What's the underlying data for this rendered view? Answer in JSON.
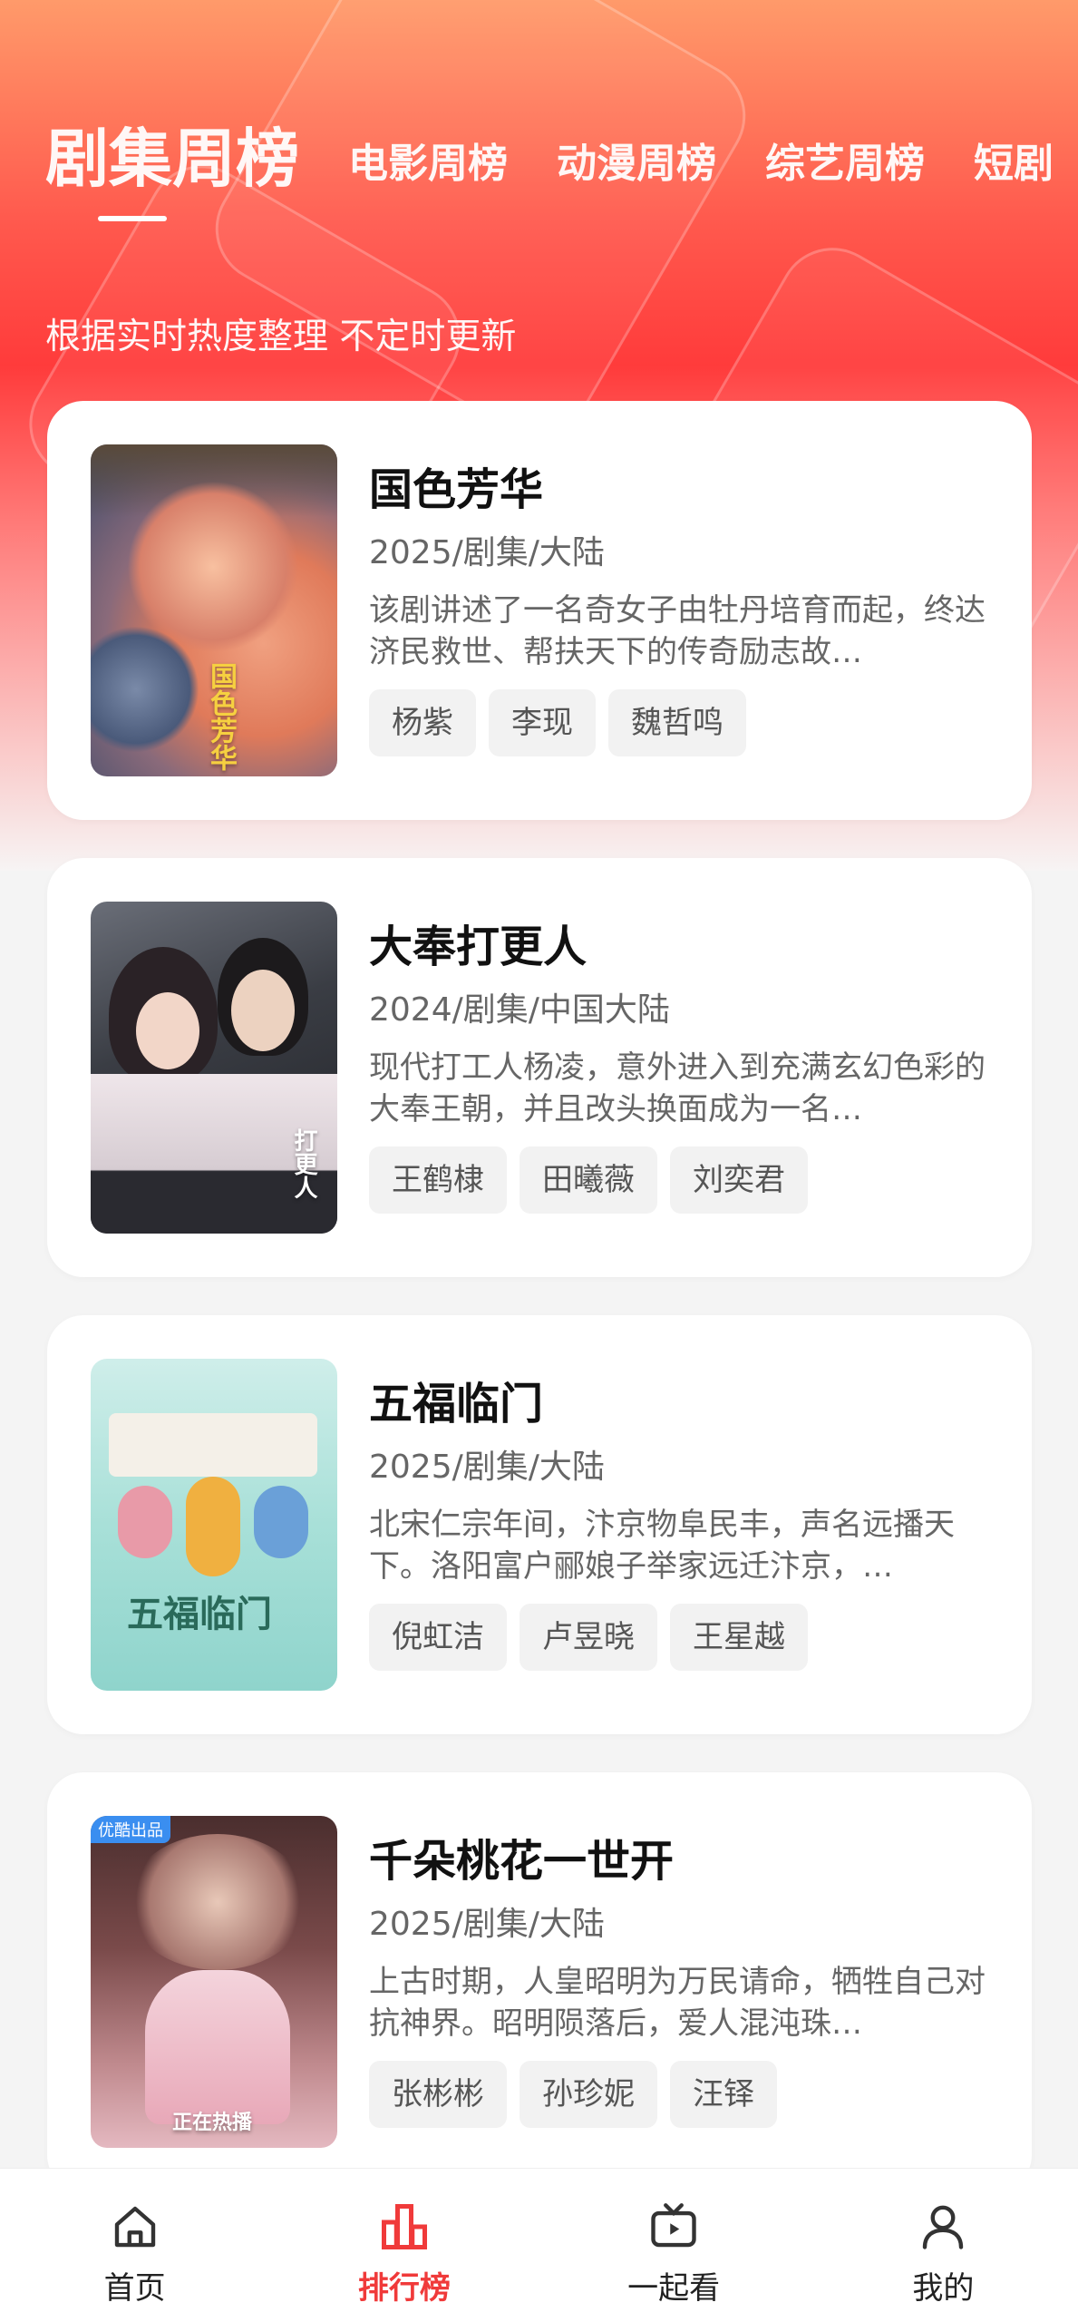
{
  "tabs": [
    {
      "label": "剧集周榜",
      "active": true
    },
    {
      "label": "电影周榜"
    },
    {
      "label": "动漫周榜"
    },
    {
      "label": "综艺周榜"
    },
    {
      "label": "短剧"
    }
  ],
  "subtitle": "根据实时热度整理 不定时更新",
  "items": [
    {
      "title": "国色芳华",
      "meta": "2025/剧集/大陆",
      "desc": "该剧讲述了一名奇女子由牡丹培育而起，终达济民救世、帮扶天下的传奇励志故…",
      "tags": [
        "杨紫",
        "李现",
        "魏哲鸣"
      ],
      "poster_text": "国色芳华"
    },
    {
      "title": "大奉打更人",
      "meta": "2024/剧集/中国大陆",
      "desc": "现代打工人杨凌，意外进入到充满玄幻色彩的大奉王朝，并且改头换面成为一名…",
      "tags": [
        "王鹤棣",
        "田曦薇",
        "刘奕君"
      ],
      "poster_text": "打更人"
    },
    {
      "title": "五福临门",
      "meta": "2025/剧集/大陆",
      "desc": "北宋仁宗年间，汴京物阜民丰，声名远播天下。洛阳富户郦娘子举家远迁汴京，…",
      "tags": [
        "倪虹洁",
        "卢昱晓",
        "王星越"
      ],
      "poster_text": "五福临门"
    },
    {
      "title": "千朵桃花一世开",
      "meta": "2025/剧集/大陆",
      "desc": "上古时期，人皇昭明为万民请命，牺牲自己对抗神界。昭明陨落后，爱人混沌珠…",
      "tags": [
        "张彬彬",
        "孙珍妮",
        "汪铎"
      ],
      "poster_text": "正在热播",
      "poster_badge": "优酷出品"
    }
  ],
  "nav": [
    {
      "label": "首页",
      "icon": "home-icon"
    },
    {
      "label": "排行榜",
      "icon": "ranking-icon",
      "active": true
    },
    {
      "label": "一起看",
      "icon": "tv-icon"
    },
    {
      "label": "我的",
      "icon": "user-icon"
    }
  ],
  "colors": {
    "accent": "#f03a3a",
    "hero_top": "#ff9a6a",
    "hero_mid": "#ff3b3b"
  }
}
